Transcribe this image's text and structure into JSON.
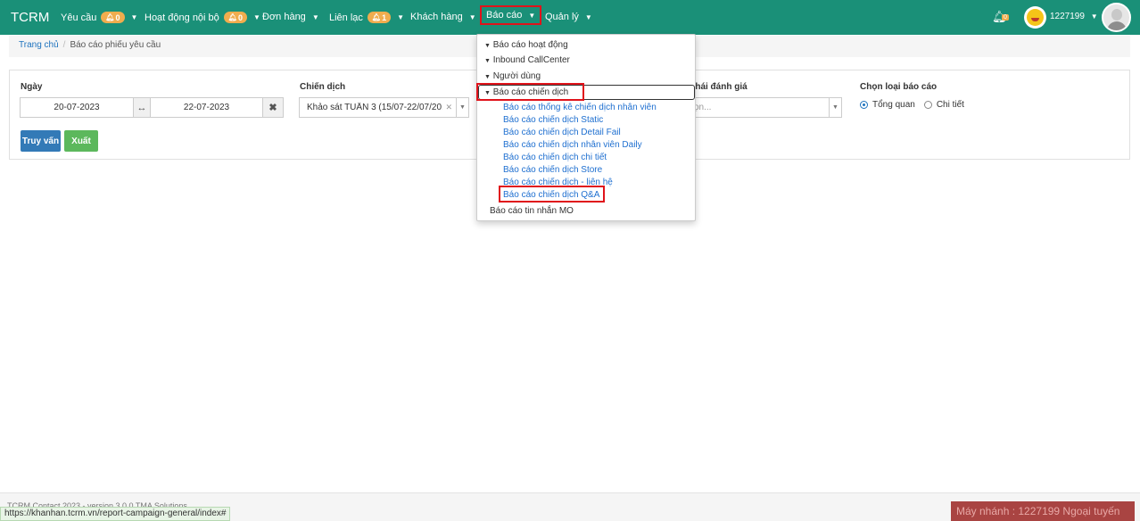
{
  "navbar": {
    "brand": "TCRM",
    "items": [
      {
        "label": "Yêu cầu",
        "badge": "0"
      },
      {
        "label": "Hoạt động nội bộ",
        "badge": "0"
      },
      {
        "label": "Đơn hàng"
      },
      {
        "label": "Liên lạc",
        "badge": "1"
      },
      {
        "label": "Khách hàng"
      },
      {
        "label": "Báo cáo"
      },
      {
        "label": "Quản lý"
      }
    ],
    "notification_badge": "0",
    "username": "1227199"
  },
  "breadcrumb": {
    "home": "Trang chủ",
    "current": "Báo cáo phiếu yêu cầu"
  },
  "filters": {
    "date_label": "Ngày",
    "date_from": "20-07-2023",
    "date_to": "22-07-2023",
    "campaign_label": "Chiến dịch",
    "campaign_value": "Khảo sát TUẦN 3 (15/07-22/07/20...",
    "status_label": "thái đánh giá",
    "status_value": "ọn...",
    "report_type_label": "Chọn loại báo cáo",
    "report_type_options": [
      "Tổng quan",
      "Chi tiết"
    ],
    "report_type_selected": "Tổng quan",
    "query_button": "Truy vấn",
    "export_button": "Xuất"
  },
  "report_menu": {
    "groups": [
      {
        "label": "Báo cáo hoạt động"
      },
      {
        "label": "Inbound CallCenter"
      },
      {
        "label": "Người dùng"
      },
      {
        "label": "Báo cáo chiến dịch",
        "expanded": true,
        "items": [
          "Báo cáo thống kê chiến dịch nhân viên",
          "Báo cáo chiến dịch Static",
          "Báo cáo chiến dịch Detail Fail",
          "Báo cáo chiến dịch nhân viên Daily",
          "Báo cáo chiến dịch chi tiết",
          "Báo cáo chiến dịch Store",
          "Báo cáo chiến dịch - liên hệ",
          "Báo cáo chiến dịch Q&A"
        ]
      }
    ],
    "extra_item": "Báo cáo tin nhắn MO"
  },
  "footer": {
    "copyright": "TCRM Contact 2023 - version 3.0.0 TMA Solutions",
    "status_url": "https://khanhan.tcrm.vn/report-campaign-general/index#",
    "machine_status": "Máy nhánh : 1227199 Ngoại tuyến"
  },
  "colors": {
    "navbar": "#1a9078",
    "badge": "#f0ad4e",
    "highlight": "#e0131b",
    "link": "#1e6fd0",
    "primary_button": "#337ab7",
    "success_button": "#5cb85c",
    "offline_status": "#a94442"
  }
}
